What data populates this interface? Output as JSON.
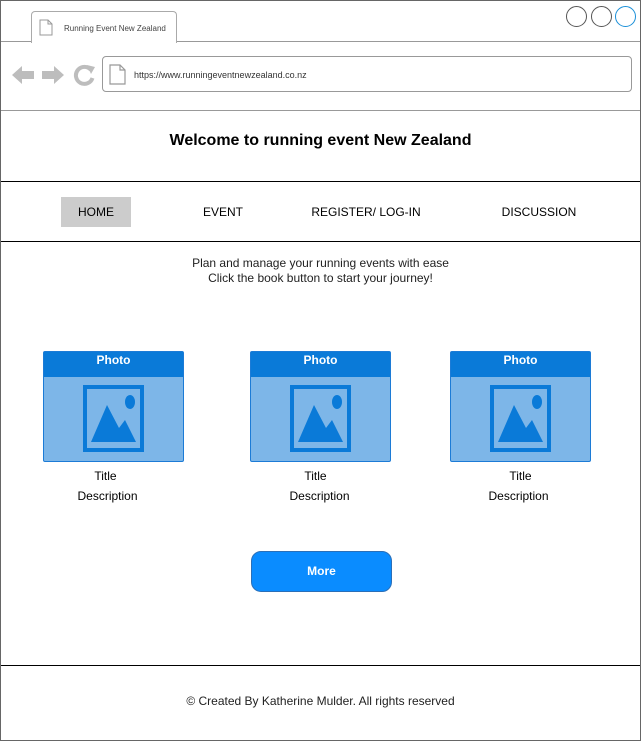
{
  "browser": {
    "tab_title": "Running Event New Zealand",
    "url": "https://www.runningeventnewzealand.co.nz",
    "icons": [
      "document-icon",
      "back-arrow-icon",
      "forward-arrow-icon",
      "reload-icon"
    ]
  },
  "header": {
    "title": "Welcome to running event New Zealand"
  },
  "nav": {
    "items": [
      {
        "label": "HOME",
        "active": true
      },
      {
        "label": "EVENT"
      },
      {
        "label": "REGISTER/ LOG-IN"
      },
      {
        "label": "DISCUSSION"
      }
    ]
  },
  "intro": {
    "line1": "Plan and manage your running events with ease",
    "line2": "Click the book button to start your journey!"
  },
  "cards": [
    {
      "header": "Photo",
      "title": "Title",
      "description": "Description",
      "icon": "image-placeholder-icon"
    },
    {
      "header": "Photo",
      "title": "Title",
      "description": "Description",
      "icon": "image-placeholder-icon"
    },
    {
      "header": "Photo",
      "title": "Title",
      "description": "Description",
      "icon": "image-placeholder-icon"
    }
  ],
  "more_button": {
    "label": "More"
  },
  "footer": {
    "text": "© Created By Katherine Mulder. All rights reserved"
  },
  "colors": {
    "nav_active_bg": "#cccccc",
    "card_header": "#0a7ad8",
    "card_body": "#7db6e8",
    "button": "#0a8cff"
  }
}
